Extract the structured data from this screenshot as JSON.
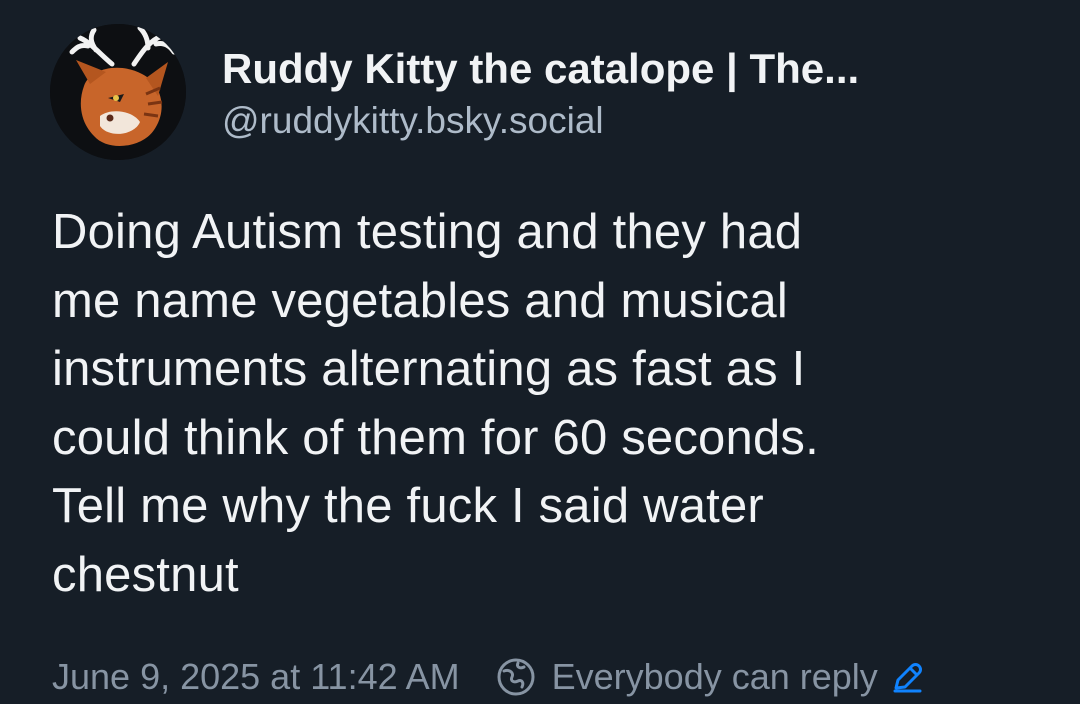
{
  "author": {
    "display_name": "Ruddy Kitty the catalope | The...",
    "handle": "@ruddykitty.bsky.social",
    "avatar_icon": "catalope-avatar"
  },
  "post": {
    "lines": [
      "Doing Autism testing and they had",
      "me name vegetables and musical",
      "instruments alternating as fast as I",
      "could think of them for 60 seconds.",
      "Tell me why the fuck I said water",
      "chestnut"
    ]
  },
  "meta": {
    "timestamp": "June 9, 2025 at 11:42 AM",
    "reply_setting_icon": "globe-icon",
    "reply_setting": "Everybody can reply",
    "edit_icon": "pencil-icon"
  },
  "colors": {
    "background": "#161e27",
    "text": "#f1f3f5",
    "handle": "#aebbc9",
    "meta": "#8794a3",
    "accent": "#1083fe"
  }
}
